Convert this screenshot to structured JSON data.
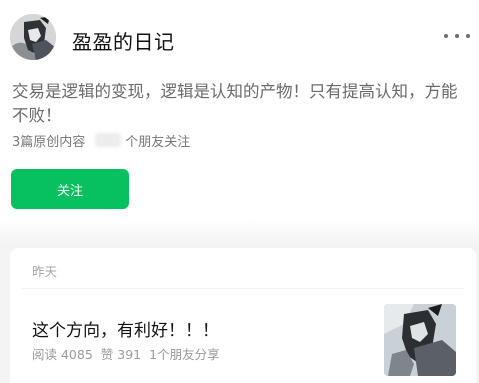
{
  "profile": {
    "name": "盈盈的日记",
    "bio": "交易是逻辑的变现，逻辑是认知的产物！只有提高认知，方能不败！",
    "original_count": "3篇原创内容",
    "friends_follow": "个朋友关注",
    "follow_label": "关注",
    "more_icon": "more-dots-icon"
  },
  "article": {
    "date": "昨天",
    "title": "这个方向，有利好！！！",
    "reads": "阅读 4085",
    "likes": "赞 391",
    "shares": "1个朋友分享"
  },
  "colors": {
    "accent": "#07c160",
    "background_band": "#f4f4f4"
  }
}
